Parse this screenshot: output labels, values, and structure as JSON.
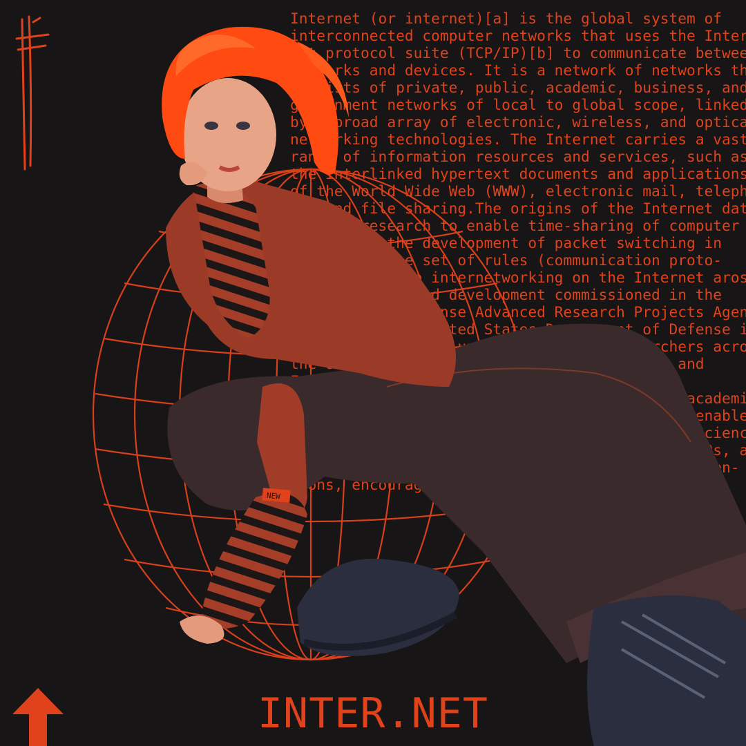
{
  "poster": {
    "title": "INTER.NET",
    "body_text": "Internet (or internet)[a] is the global system of\ninterconnected computer networks that uses the Inter-\nnet protocol suite (TCP/IP)[b] to communicate between\nnetworks and devices. It is a network of networks that\nconsists of private, public, academic, business, and\ngovernment networks of local to global scope, linked\nby a broad array of electronic, wireless, and optical\nnetworking technologies. The Internet carries a vast\nrange of information resources and services, such as\nthe interlinked hypertext documents and applications\nof the World Wide Web (WWW), electronic mail, telepho-\nny, and file sharing.The origins of the Internet date\nback to research to enable time-sharing of computer\nresources, the development of packet switching in\nthe 1960s. The set of rules (communication proto-\ncols) to enable internetworking on the Internet arose\nfrom research and development commissioned in the\n1970s by the Defense Advanced Research Projects Agency\n(DARPA) of the United States Department of Defense in\ncollaboration with universities and researchers across\nthe United States and in the United Kingdom and\nFrance. The ARPANET initially served as a\nbackbone for the interconnection of regional academic\nand military networks in the United States to enable\nresource sharing. The funding of the National Science\nFoundation Network as a new backbone in the 1980s, as\nwell as private funding for other commercial exten-\nsions, encouraged worldwide participation",
    "sleeve_label": "NEW"
  },
  "colors": {
    "background": "#171515",
    "accent": "#e0421c",
    "hair": "#ff4a12",
    "sweater": "#9b3a26",
    "stripes": "#1c1616",
    "pants": "#3a2a2c",
    "shoes": "#2b2e3e",
    "skin": "#e49a7c"
  },
  "icons": [
    "globe-wireframe-icon",
    "arrow-up-icon",
    "scribble-mark-icon"
  ]
}
